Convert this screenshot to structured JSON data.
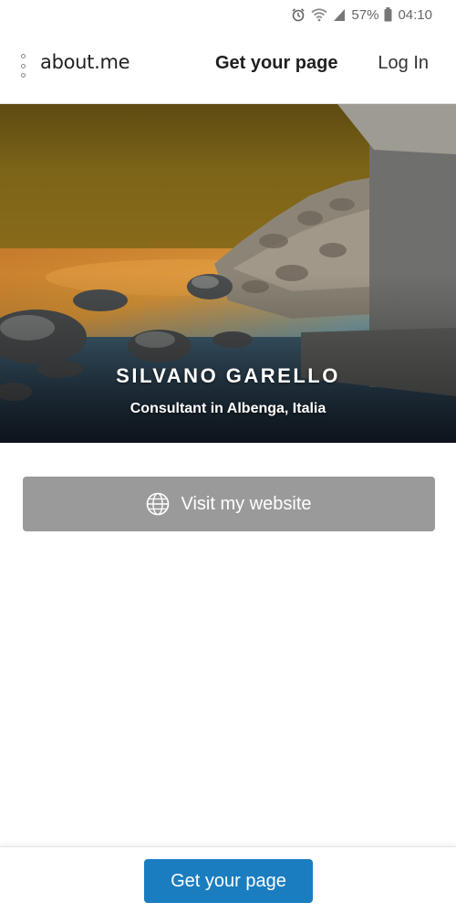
{
  "status_bar": {
    "battery_percent": "57%",
    "time": "04:10",
    "icons": [
      "alarm-icon",
      "wifi-icon",
      "signal-icon",
      "battery-icon"
    ]
  },
  "header": {
    "logo": "about.me",
    "get_page_label": "Get your page",
    "login_label": "Log In"
  },
  "profile": {
    "name": "SILVANO GARELLO",
    "subtitle": "Consultant in Albenga, Italia"
  },
  "website_button": {
    "label": "Visit my website",
    "icon": "globe-icon",
    "color": "#9a9a9a"
  },
  "footer": {
    "cta_label": "Get your page",
    "cta_color": "#1a7dc0"
  }
}
